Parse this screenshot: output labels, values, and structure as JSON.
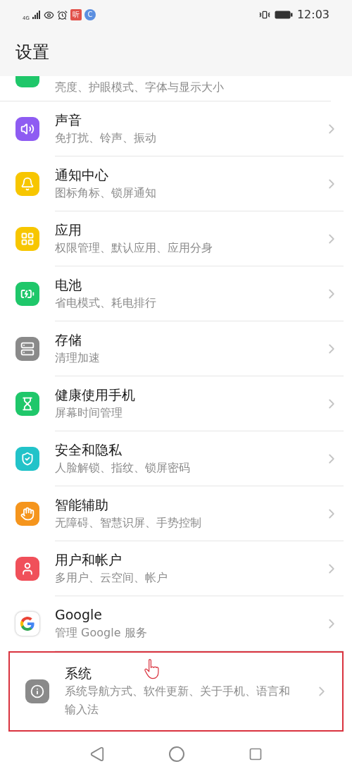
{
  "status_bar": {
    "network": "4G",
    "app_badges": [
      "听",
      "C"
    ],
    "time": "12:03"
  },
  "title": "设置",
  "partial_item": {
    "subtitle": "亮度、护眼模式、字体与显示大小",
    "color": "#1fc76a"
  },
  "items": [
    {
      "title": "声音",
      "subtitle": "免打扰、铃声、振动",
      "color": "#8e5cf2",
      "highlighted": false
    },
    {
      "title": "通知中心",
      "subtitle": "图标角标、锁屏通知",
      "color": "#f7c600",
      "highlighted": false
    },
    {
      "title": "应用",
      "subtitle": "权限管理、默认应用、应用分身",
      "color": "#f7c600",
      "highlighted": false
    },
    {
      "title": "电池",
      "subtitle": "省电模式、耗电排行",
      "color": "#1fc76a",
      "highlighted": false
    },
    {
      "title": "存储",
      "subtitle": "清理加速",
      "color": "#8a8a8a",
      "highlighted": false
    },
    {
      "title": "健康使用手机",
      "subtitle": "屏幕时间管理",
      "color": "#1fc76a",
      "highlighted": false
    },
    {
      "title": "安全和隐私",
      "subtitle": "人脸解锁、指纹、锁屏密码",
      "color": "#22c3c9",
      "highlighted": false
    },
    {
      "title": "智能辅助",
      "subtitle": "无障碍、智慧识屏、手势控制",
      "color": "#f5951d",
      "highlighted": false
    },
    {
      "title": "用户和帐户",
      "subtitle": "多用户、云空间、帐户",
      "color": "#f0505a",
      "highlighted": false
    },
    {
      "title": "Google",
      "subtitle": "管理 Google 服务",
      "color": "#ffffff",
      "highlighted": false
    },
    {
      "title": "系统",
      "subtitle": "系统导航方式、软件更新、关于手机、语言和输入法",
      "color": "#8a8a8a",
      "highlighted": true
    }
  ]
}
